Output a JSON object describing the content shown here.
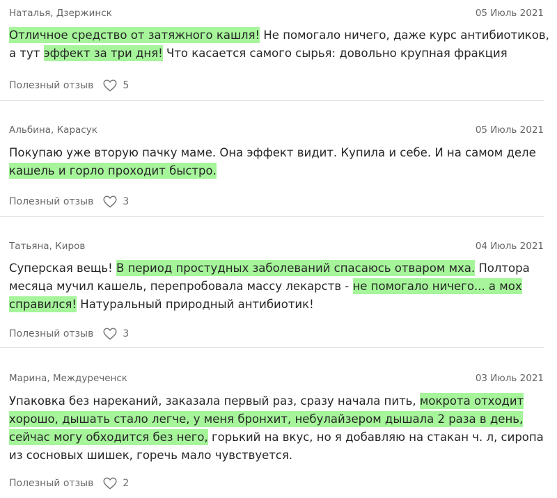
{
  "reviews": [
    {
      "author": "Наталья, Дзержинск",
      "date": "05 Июль 2021",
      "text_parts": [
        {
          "t": "Отличное средство от затяжного кашля!",
          "hl": true
        },
        {
          "t": " Не помогало ничего, даже курс антибиотиков, а тут ",
          "hl": false
        },
        {
          "t": "эффект за три дня!",
          "hl": true
        },
        {
          "t": " Что касается самого сырья: довольно крупная фракция",
          "hl": false
        }
      ],
      "useful_label": "Полезный отзыв",
      "likes": "5"
    },
    {
      "author": "Альбина, Карасук",
      "date": "05 Июль 2021",
      "text_parts": [
        {
          "t": "Покупаю уже вторую пачку маме. Она эффект видит. Купила и себе. И на самом деле ",
          "hl": false
        },
        {
          "t": "кашель и горло проходит быстро.",
          "hl": true
        }
      ],
      "useful_label": "Полезный отзыв",
      "likes": "3"
    },
    {
      "author": "Татьяна, Киров",
      "date": "04 Июль 2021",
      "text_parts": [
        {
          "t": "Суперская вещь! ",
          "hl": false
        },
        {
          "t": "В период простудных заболеваний спасаюсь отваром мха.",
          "hl": true
        },
        {
          "t": " Полтора месяца мучил кашель, перепробовала массу лекарств - ",
          "hl": false
        },
        {
          "t": "не помогало ничего... а мох справился!",
          "hl": true
        },
        {
          "t": " Натуральный природный антибиотик!",
          "hl": false
        }
      ],
      "useful_label": "Полезный отзыв",
      "likes": "3"
    },
    {
      "author": "Марина, Междуреченск",
      "date": "03 Июль 2021",
      "text_parts": [
        {
          "t": "Упаковка без нареканий, заказала первый раз, сразу начала пить, ",
          "hl": false
        },
        {
          "t": "мокрота отходит хорошо, дышать стало легче, у меня бронхит, небулайзером дышала 2 раза в день, сейчас могу обходится без него,",
          "hl": true
        },
        {
          "t": " горький на вкус, но я добавляю на стакан ч. л, сиропа из сосновых шишек, горечь мало чувствуется.",
          "hl": false
        }
      ],
      "useful_label": "Полезный отзыв",
      "likes": "2"
    }
  ],
  "colors": {
    "highlight": "#a6f59b",
    "meta_text": "#666666",
    "body_text": "#262626",
    "separator": "#e3e3e3"
  },
  "icons": {
    "like": "heart-outline-icon"
  }
}
